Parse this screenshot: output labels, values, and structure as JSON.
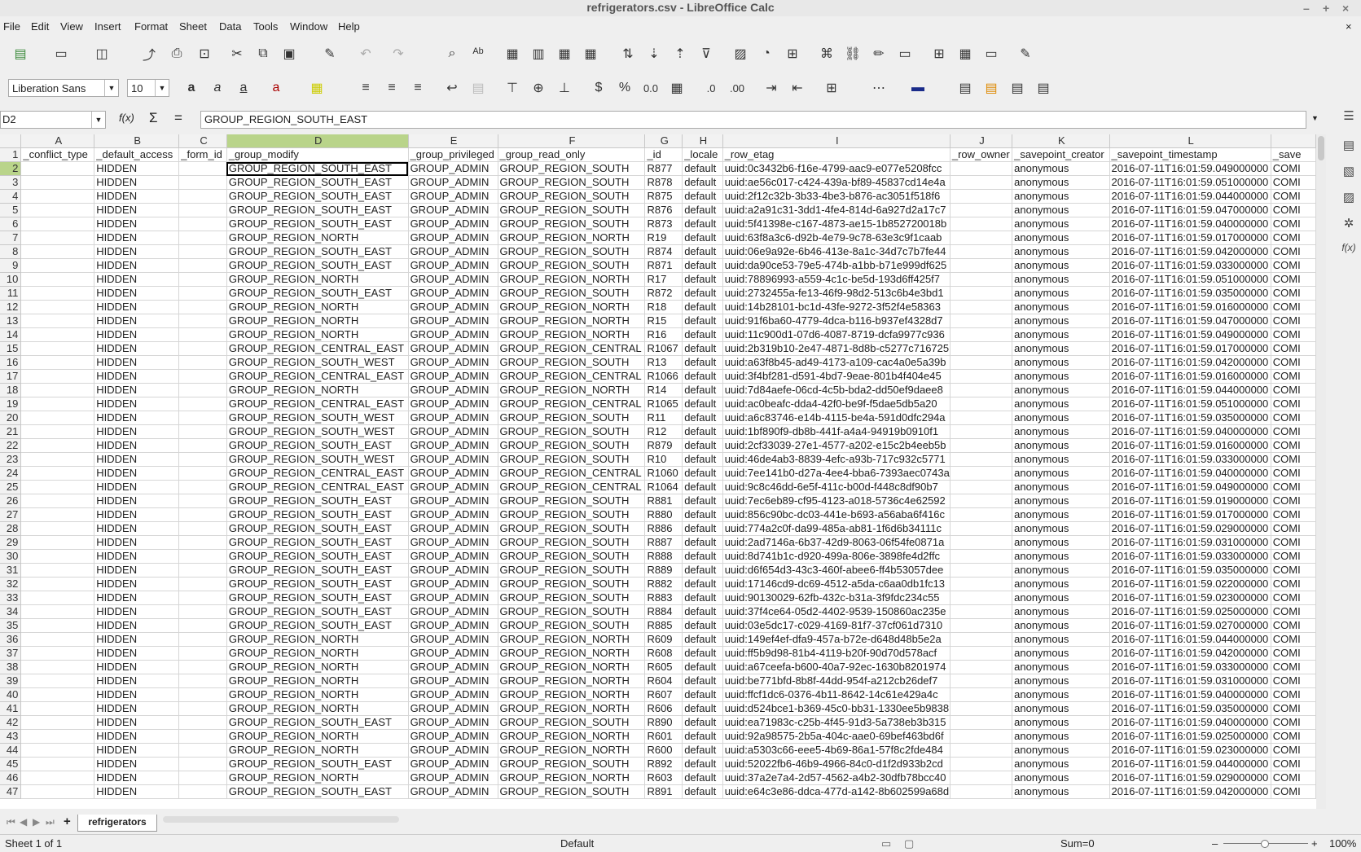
{
  "window": {
    "title": "refrigerators.csv - LibreOffice Calc"
  },
  "menu": [
    "File",
    "Edit",
    "View",
    "Insert",
    "Format",
    "Sheet",
    "Data",
    "Tools",
    "Window",
    "Help"
  ],
  "format_bar": {
    "font_name": "Liberation Sans",
    "font_size": "10"
  },
  "formula_bar": {
    "cell_ref": "D2",
    "fx_label": "f(x)",
    "sum_symbol": "Σ",
    "equals_symbol": "=",
    "content": "GROUP_REGION_SOUTH_EAST"
  },
  "columns": [
    "A",
    "B",
    "C",
    "D",
    "E",
    "F",
    "G",
    "H",
    "I",
    "J",
    "K",
    "L"
  ],
  "headers": [
    "_conflict_type",
    "_default_access",
    "_form_id",
    "_group_modify",
    "_group_privileged",
    "_group_read_only",
    "_id",
    "_locale",
    "_row_etag",
    "_row_owner",
    "_savepoint_creator",
    "_savepoint_timestamp",
    "_save"
  ],
  "rows": [
    [
      "",
      "HIDDEN",
      "",
      "GROUP_REGION_SOUTH_EAST",
      "GROUP_ADMIN",
      "GROUP_REGION_SOUTH",
      "R877",
      "default",
      "uuid:0c3432b6-f16e-4799-aac9-e077e5208fcc",
      "",
      "anonymous",
      "2016-07-11T16:01:59.049000000",
      "COMI"
    ],
    [
      "",
      "HIDDEN",
      "",
      "GROUP_REGION_SOUTH_EAST",
      "GROUP_ADMIN",
      "GROUP_REGION_SOUTH",
      "R878",
      "default",
      "uuid:ae56c017-c424-439a-bf89-45837cd14e4a",
      "",
      "anonymous",
      "2016-07-11T16:01:59.051000000",
      "COMI"
    ],
    [
      "",
      "HIDDEN",
      "",
      "GROUP_REGION_SOUTH_EAST",
      "GROUP_ADMIN",
      "GROUP_REGION_SOUTH",
      "R875",
      "default",
      "uuid:2f12c32b-3b33-4be3-b876-ac3051f518f6",
      "",
      "anonymous",
      "2016-07-11T16:01:59.044000000",
      "COMI"
    ],
    [
      "",
      "HIDDEN",
      "",
      "GROUP_REGION_SOUTH_EAST",
      "GROUP_ADMIN",
      "GROUP_REGION_SOUTH",
      "R876",
      "default",
      "uuid:a2a91c31-3dd1-4fe4-814d-6a927d2a17c7",
      "",
      "anonymous",
      "2016-07-11T16:01:59.047000000",
      "COMI"
    ],
    [
      "",
      "HIDDEN",
      "",
      "GROUP_REGION_SOUTH_EAST",
      "GROUP_ADMIN",
      "GROUP_REGION_SOUTH",
      "R873",
      "default",
      "uuid:5f41398e-c167-4873-ae15-1b852720018b",
      "",
      "anonymous",
      "2016-07-11T16:01:59.040000000",
      "COMI"
    ],
    [
      "",
      "HIDDEN",
      "",
      "GROUP_REGION_NORTH",
      "GROUP_ADMIN",
      "GROUP_REGION_NORTH",
      "R19",
      "default",
      "uuid:63f8a3c6-d92b-4e79-9c78-63e3c9f1caab",
      "",
      "anonymous",
      "2016-07-11T16:01:59.017000000",
      "COMI"
    ],
    [
      "",
      "HIDDEN",
      "",
      "GROUP_REGION_SOUTH_EAST",
      "GROUP_ADMIN",
      "GROUP_REGION_SOUTH",
      "R874",
      "default",
      "uuid:06e9a92e-6b46-413e-8a1c-34d7c7b7fe44",
      "",
      "anonymous",
      "2016-07-11T16:01:59.042000000",
      "COMI"
    ],
    [
      "",
      "HIDDEN",
      "",
      "GROUP_REGION_SOUTH_EAST",
      "GROUP_ADMIN",
      "GROUP_REGION_SOUTH",
      "R871",
      "default",
      "uuid:da90ce53-79e5-474b-a1bb-b71e999df625",
      "",
      "anonymous",
      "2016-07-11T16:01:59.033000000",
      "COMI"
    ],
    [
      "",
      "HIDDEN",
      "",
      "GROUP_REGION_NORTH",
      "GROUP_ADMIN",
      "GROUP_REGION_NORTH",
      "R17",
      "default",
      "uuid:78896993-a559-4c1c-be5d-193d6ff425f7",
      "",
      "anonymous",
      "2016-07-11T16:01:59.051000000",
      "COMI"
    ],
    [
      "",
      "HIDDEN",
      "",
      "GROUP_REGION_SOUTH_EAST",
      "GROUP_ADMIN",
      "GROUP_REGION_SOUTH",
      "R872",
      "default",
      "uuid:2732455a-fe13-46f9-98d2-513c6b4e3bd1",
      "",
      "anonymous",
      "2016-07-11T16:01:59.035000000",
      "COMI"
    ],
    [
      "",
      "HIDDEN",
      "",
      "GROUP_REGION_NORTH",
      "GROUP_ADMIN",
      "GROUP_REGION_NORTH",
      "R18",
      "default",
      "uuid:14b28101-bc1d-43fe-9272-3f52f4e58363",
      "",
      "anonymous",
      "2016-07-11T16:01:59.016000000",
      "COMI"
    ],
    [
      "",
      "HIDDEN",
      "",
      "GROUP_REGION_NORTH",
      "GROUP_ADMIN",
      "GROUP_REGION_NORTH",
      "R15",
      "default",
      "uuid:91f6ba60-4779-4dca-b116-b937ef4328d7",
      "",
      "anonymous",
      "2016-07-11T16:01:59.047000000",
      "COMI"
    ],
    [
      "",
      "HIDDEN",
      "",
      "GROUP_REGION_NORTH",
      "GROUP_ADMIN",
      "GROUP_REGION_NORTH",
      "R16",
      "default",
      "uuid:11c900d1-07d6-4087-8719-dcfa9977c936",
      "",
      "anonymous",
      "2016-07-11T16:01:59.049000000",
      "COMI"
    ],
    [
      "",
      "HIDDEN",
      "",
      "GROUP_REGION_CENTRAL_EAST",
      "GROUP_ADMIN",
      "GROUP_REGION_CENTRAL",
      "R1067",
      "default",
      "uuid:2b319b10-2e47-4871-8d8b-c5277c716725",
      "",
      "anonymous",
      "2016-07-11T16:01:59.017000000",
      "COMI"
    ],
    [
      "",
      "HIDDEN",
      "",
      "GROUP_REGION_SOUTH_WEST",
      "GROUP_ADMIN",
      "GROUP_REGION_SOUTH",
      "R13",
      "default",
      "uuid:a63f8b45-ad49-4173-a109-cac4a0e5a39b",
      "",
      "anonymous",
      "2016-07-11T16:01:59.042000000",
      "COMI"
    ],
    [
      "",
      "HIDDEN",
      "",
      "GROUP_REGION_CENTRAL_EAST",
      "GROUP_ADMIN",
      "GROUP_REGION_CENTRAL",
      "R1066",
      "default",
      "uuid:3f4bf281-d591-4bd7-9eae-801b4f404e45",
      "",
      "anonymous",
      "2016-07-11T16:01:59.016000000",
      "COMI"
    ],
    [
      "",
      "HIDDEN",
      "",
      "GROUP_REGION_NORTH",
      "GROUP_ADMIN",
      "GROUP_REGION_NORTH",
      "R14",
      "default",
      "uuid:7d84aefe-06cd-4c5b-bda2-dd50ef9daee8",
      "",
      "anonymous",
      "2016-07-11T16:01:59.044000000",
      "COMI"
    ],
    [
      "",
      "HIDDEN",
      "",
      "GROUP_REGION_CENTRAL_EAST",
      "GROUP_ADMIN",
      "GROUP_REGION_CENTRAL",
      "R1065",
      "default",
      "uuid:ac0beafc-dda4-42f0-be9f-f5dae5db5a20",
      "",
      "anonymous",
      "2016-07-11T16:01:59.051000000",
      "COMI"
    ],
    [
      "",
      "HIDDEN",
      "",
      "GROUP_REGION_SOUTH_WEST",
      "GROUP_ADMIN",
      "GROUP_REGION_SOUTH",
      "R11",
      "default",
      "uuid:a6c83746-e14b-4115-be4a-591d0dfc294a",
      "",
      "anonymous",
      "2016-07-11T16:01:59.035000000",
      "COMI"
    ],
    [
      "",
      "HIDDEN",
      "",
      "GROUP_REGION_SOUTH_WEST",
      "GROUP_ADMIN",
      "GROUP_REGION_SOUTH",
      "R12",
      "default",
      "uuid:1bf890f9-db8b-441f-a4a4-94919b0910f1",
      "",
      "anonymous",
      "2016-07-11T16:01:59.040000000",
      "COMI"
    ],
    [
      "",
      "HIDDEN",
      "",
      "GROUP_REGION_SOUTH_EAST",
      "GROUP_ADMIN",
      "GROUP_REGION_SOUTH",
      "R879",
      "default",
      "uuid:2cf33039-27e1-4577-a202-e15c2b4eeb5b",
      "",
      "anonymous",
      "2016-07-11T16:01:59.016000000",
      "COMI"
    ],
    [
      "",
      "HIDDEN",
      "",
      "GROUP_REGION_SOUTH_WEST",
      "GROUP_ADMIN",
      "GROUP_REGION_SOUTH",
      "R10",
      "default",
      "uuid:46de4ab3-8839-4efc-a93b-717c932c5771",
      "",
      "anonymous",
      "2016-07-11T16:01:59.033000000",
      "COMI"
    ],
    [
      "",
      "HIDDEN",
      "",
      "GROUP_REGION_CENTRAL_EAST",
      "GROUP_ADMIN",
      "GROUP_REGION_CENTRAL",
      "R1060",
      "default",
      "uuid:7ee141b0-d27a-4ee4-bba6-7393aec0743a",
      "",
      "anonymous",
      "2016-07-11T16:01:59.040000000",
      "COMI"
    ],
    [
      "",
      "HIDDEN",
      "",
      "GROUP_REGION_CENTRAL_EAST",
      "GROUP_ADMIN",
      "GROUP_REGION_CENTRAL",
      "R1064",
      "default",
      "uuid:9c8c46dd-6e5f-411c-b00d-f448c8df90b7",
      "",
      "anonymous",
      "2016-07-11T16:01:59.049000000",
      "COMI"
    ],
    [
      "",
      "HIDDEN",
      "",
      "GROUP_REGION_SOUTH_EAST",
      "GROUP_ADMIN",
      "GROUP_REGION_SOUTH",
      "R881",
      "default",
      "uuid:7ec6eb89-cf95-4123-a018-5736c4e62592",
      "",
      "anonymous",
      "2016-07-11T16:01:59.019000000",
      "COMI"
    ],
    [
      "",
      "HIDDEN",
      "",
      "GROUP_REGION_SOUTH_EAST",
      "GROUP_ADMIN",
      "GROUP_REGION_SOUTH",
      "R880",
      "default",
      "uuid:856c90bc-dc03-441e-b693-a56aba6f416c",
      "",
      "anonymous",
      "2016-07-11T16:01:59.017000000",
      "COMI"
    ],
    [
      "",
      "HIDDEN",
      "",
      "GROUP_REGION_SOUTH_EAST",
      "GROUP_ADMIN",
      "GROUP_REGION_SOUTH",
      "R886",
      "default",
      "uuid:774a2c0f-da99-485a-ab81-1f6d6b34111c",
      "",
      "anonymous",
      "2016-07-11T16:01:59.029000000",
      "COMI"
    ],
    [
      "",
      "HIDDEN",
      "",
      "GROUP_REGION_SOUTH_EAST",
      "GROUP_ADMIN",
      "GROUP_REGION_SOUTH",
      "R887",
      "default",
      "uuid:2ad7146a-6b37-42d9-8063-06f54fe0871a",
      "",
      "anonymous",
      "2016-07-11T16:01:59.031000000",
      "COMI"
    ],
    [
      "",
      "HIDDEN",
      "",
      "GROUP_REGION_SOUTH_EAST",
      "GROUP_ADMIN",
      "GROUP_REGION_SOUTH",
      "R888",
      "default",
      "uuid:8d741b1c-d920-499a-806e-3898fe4d2ffc",
      "",
      "anonymous",
      "2016-07-11T16:01:59.033000000",
      "COMI"
    ],
    [
      "",
      "HIDDEN",
      "",
      "GROUP_REGION_SOUTH_EAST",
      "GROUP_ADMIN",
      "GROUP_REGION_SOUTH",
      "R889",
      "default",
      "uuid:d6f654d3-43c3-460f-abee6-ff4b53057dee",
      "",
      "anonymous",
      "2016-07-11T16:01:59.035000000",
      "COMI"
    ],
    [
      "",
      "HIDDEN",
      "",
      "GROUP_REGION_SOUTH_EAST",
      "GROUP_ADMIN",
      "GROUP_REGION_SOUTH",
      "R882",
      "default",
      "uuid:17146cd9-dc69-4512-a5da-c6aa0db1fc13",
      "",
      "anonymous",
      "2016-07-11T16:01:59.022000000",
      "COMI"
    ],
    [
      "",
      "HIDDEN",
      "",
      "GROUP_REGION_SOUTH_EAST",
      "GROUP_ADMIN",
      "GROUP_REGION_SOUTH",
      "R883",
      "default",
      "uuid:90130029-62fb-432c-b31a-3f9fdc234c55",
      "",
      "anonymous",
      "2016-07-11T16:01:59.023000000",
      "COMI"
    ],
    [
      "",
      "HIDDEN",
      "",
      "GROUP_REGION_SOUTH_EAST",
      "GROUP_ADMIN",
      "GROUP_REGION_SOUTH",
      "R884",
      "default",
      "uuid:37f4ce64-05d2-4402-9539-150860ac235e",
      "",
      "anonymous",
      "2016-07-11T16:01:59.025000000",
      "COMI"
    ],
    [
      "",
      "HIDDEN",
      "",
      "GROUP_REGION_SOUTH_EAST",
      "GROUP_ADMIN",
      "GROUP_REGION_SOUTH",
      "R885",
      "default",
      "uuid:03e5dc17-c029-4169-81f7-37cf061d7310",
      "",
      "anonymous",
      "2016-07-11T16:01:59.027000000",
      "COMI"
    ],
    [
      "",
      "HIDDEN",
      "",
      "GROUP_REGION_NORTH",
      "GROUP_ADMIN",
      "GROUP_REGION_NORTH",
      "R609",
      "default",
      "uuid:149ef4ef-dfa9-457a-b72e-d648d48b5e2a",
      "",
      "anonymous",
      "2016-07-11T16:01:59.044000000",
      "COMI"
    ],
    [
      "",
      "HIDDEN",
      "",
      "GROUP_REGION_NORTH",
      "GROUP_ADMIN",
      "GROUP_REGION_NORTH",
      "R608",
      "default",
      "uuid:ff5b9d98-81b4-4119-b20f-90d70d578acf",
      "",
      "anonymous",
      "2016-07-11T16:01:59.042000000",
      "COMI"
    ],
    [
      "",
      "HIDDEN",
      "",
      "GROUP_REGION_NORTH",
      "GROUP_ADMIN",
      "GROUP_REGION_NORTH",
      "R605",
      "default",
      "uuid:a67ceefa-b600-40a7-92ec-1630b8201974",
      "",
      "anonymous",
      "2016-07-11T16:01:59.033000000",
      "COMI"
    ],
    [
      "",
      "HIDDEN",
      "",
      "GROUP_REGION_NORTH",
      "GROUP_ADMIN",
      "GROUP_REGION_NORTH",
      "R604",
      "default",
      "uuid:be771bfd-8b8f-44dd-954f-a212cb26def7",
      "",
      "anonymous",
      "2016-07-11T16:01:59.031000000",
      "COMI"
    ],
    [
      "",
      "HIDDEN",
      "",
      "GROUP_REGION_NORTH",
      "GROUP_ADMIN",
      "GROUP_REGION_NORTH",
      "R607",
      "default",
      "uuid:ffcf1dc6-0376-4b11-8642-14c61e429a4c",
      "",
      "anonymous",
      "2016-07-11T16:01:59.040000000",
      "COMI"
    ],
    [
      "",
      "HIDDEN",
      "",
      "GROUP_REGION_NORTH",
      "GROUP_ADMIN",
      "GROUP_REGION_NORTH",
      "R606",
      "default",
      "uuid:d524bce1-b369-45c0-bb31-1330ee5b9838",
      "",
      "anonymous",
      "2016-07-11T16:01:59.035000000",
      "COMI"
    ],
    [
      "",
      "HIDDEN",
      "",
      "GROUP_REGION_SOUTH_EAST",
      "GROUP_ADMIN",
      "GROUP_REGION_SOUTH",
      "R890",
      "default",
      "uuid:ea71983c-c25b-4f45-91d3-5a738eb3b315",
      "",
      "anonymous",
      "2016-07-11T16:01:59.040000000",
      "COMI"
    ],
    [
      "",
      "HIDDEN",
      "",
      "GROUP_REGION_NORTH",
      "GROUP_ADMIN",
      "GROUP_REGION_NORTH",
      "R601",
      "default",
      "uuid:92a98575-2b5a-404c-aae0-69bef463bd6f",
      "",
      "anonymous",
      "2016-07-11T16:01:59.025000000",
      "COMI"
    ],
    [
      "",
      "HIDDEN",
      "",
      "GROUP_REGION_NORTH",
      "GROUP_ADMIN",
      "GROUP_REGION_NORTH",
      "R600",
      "default",
      "uuid:a5303c66-eee5-4b69-86a1-57f8c2fde484",
      "",
      "anonymous",
      "2016-07-11T16:01:59.023000000",
      "COMI"
    ],
    [
      "",
      "HIDDEN",
      "",
      "GROUP_REGION_SOUTH_EAST",
      "GROUP_ADMIN",
      "GROUP_REGION_SOUTH",
      "R892",
      "default",
      "uuid:52022fb6-46b9-4966-84c0-d1f2d933b2cd",
      "",
      "anonymous",
      "2016-07-11T16:01:59.044000000",
      "COMI"
    ],
    [
      "",
      "HIDDEN",
      "",
      "GROUP_REGION_NORTH",
      "GROUP_ADMIN",
      "GROUP_REGION_NORTH",
      "R603",
      "default",
      "uuid:37a2e7a4-2d57-4562-a4b2-30dfb78bcc40",
      "",
      "anonymous",
      "2016-07-11T16:01:59.029000000",
      "COMI"
    ],
    [
      "",
      "HIDDEN",
      "",
      "GROUP_REGION_SOUTH_EAST",
      "GROUP_ADMIN",
      "GROUP_REGION_SOUTH",
      "R891",
      "default",
      "uuid:e64c3e86-ddca-477d-a142-8b602599a68d",
      "",
      "anonymous",
      "2016-07-11T16:01:59.042000000",
      "COMI"
    ]
  ],
  "sheet_tab": "refrigerators",
  "status": {
    "sheet_info": "Sheet 1 of 1",
    "page_style": "Default",
    "sum": "Sum=0",
    "zoom": "100%"
  }
}
